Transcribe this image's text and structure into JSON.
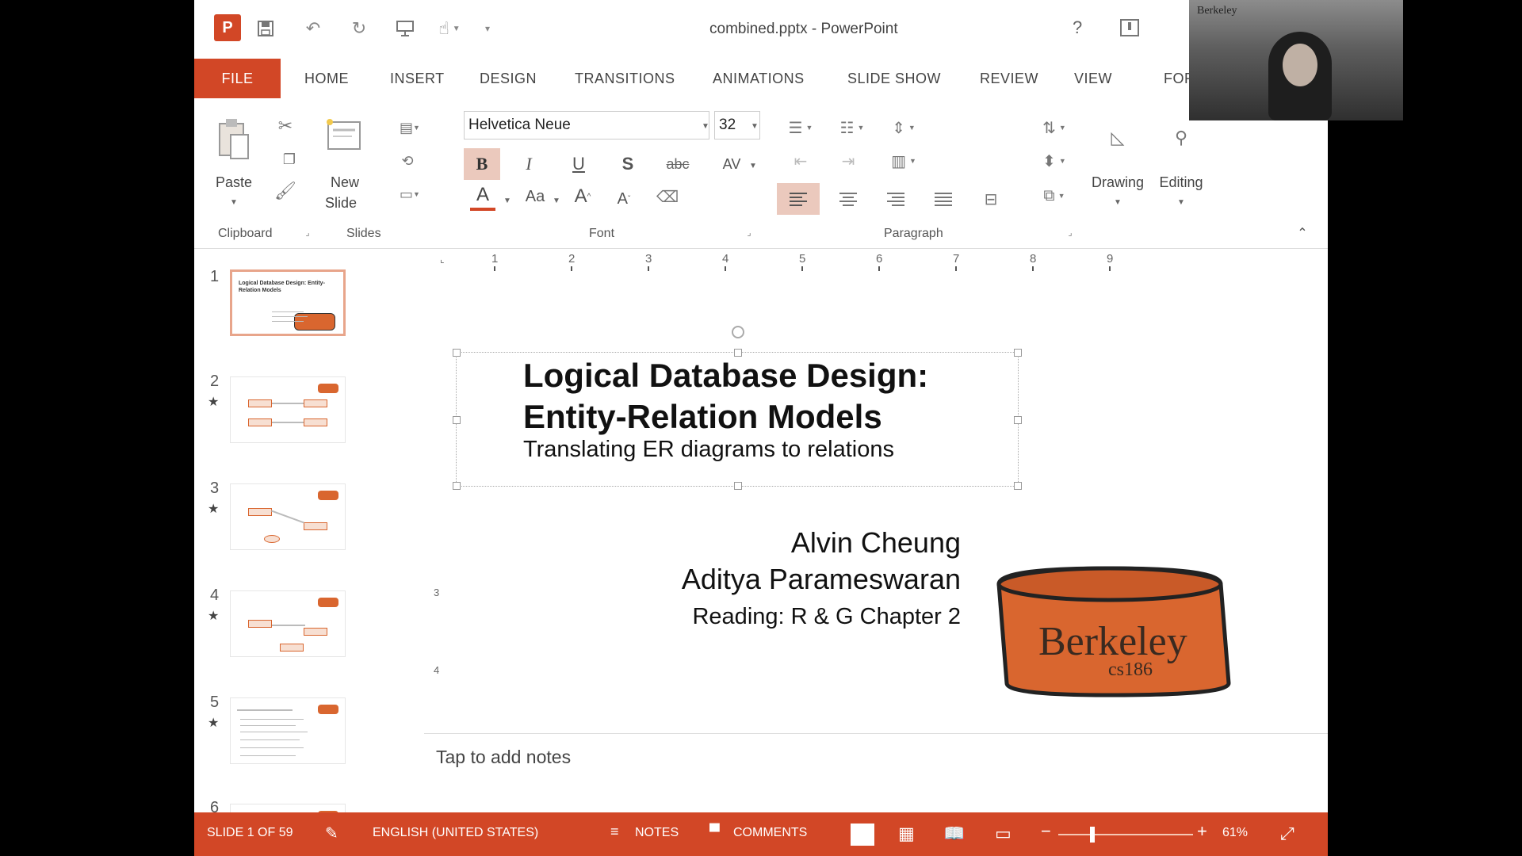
{
  "window": {
    "title": "combined.pptx - PowerPoint",
    "help": "?"
  },
  "qat": {
    "app_icon": "P",
    "save_icon": "save-icon",
    "undo_icon": "undo-icon",
    "redo_icon": "redo-icon",
    "present_icon": "present-from-beginning-icon",
    "touch_icon": "touch-mode-icon",
    "customize_icon": "customize-qat-icon"
  },
  "tabs": [
    "FILE",
    "HOME",
    "INSERT",
    "DESIGN",
    "TRANSITIONS",
    "ANIMATIONS",
    "SLIDE SHOW",
    "REVIEW",
    "VIEW",
    "FOR"
  ],
  "ribbon": {
    "paste_label": "Paste",
    "new_slide_label_1": "New",
    "new_slide_label_2": "Slide",
    "font_name": "Helvetica Neue",
    "font_size": "32",
    "drawing_label": "Drawing",
    "editing_label": "Editing",
    "groups": {
      "clipboard": "Clipboard",
      "slides": "Slides",
      "font": "Font",
      "paragraph": "Paragraph"
    },
    "glyphs": {
      "bold": "B",
      "italic": "I",
      "underline": "U",
      "shadow": "S",
      "strike": "abc",
      "spacing": "AV",
      "font_color": "A",
      "change_case": "Aa",
      "grow": "A",
      "shrink": "A"
    }
  },
  "ruler": {
    "numbers": [
      "1",
      "2",
      "3",
      "4",
      "5",
      "6",
      "7",
      "8",
      "9"
    ],
    "vertical_numbers": [
      "3",
      "4"
    ]
  },
  "thumbnails": [
    {
      "num": "1",
      "title": "Logical Database Design: Entity-Relation Models",
      "starred": false,
      "active": true
    },
    {
      "num": "2",
      "title": "",
      "starred": true,
      "active": false
    },
    {
      "num": "3",
      "title": "",
      "starred": true,
      "active": false
    },
    {
      "num": "4",
      "title": "",
      "starred": true,
      "active": false
    },
    {
      "num": "5",
      "title": "",
      "starred": true,
      "active": false
    },
    {
      "num": "6",
      "title": "",
      "starred": false,
      "active": false
    }
  ],
  "slide": {
    "title_line1": "Logical Database Design:",
    "title_line2": "Entity-Relation Models",
    "subtitle": "Translating ER diagrams to relations",
    "author1": "Alvin Cheung",
    "author2": "Aditya Parameswaran",
    "reading": "Reading: R & G Chapter 2",
    "logo_text": "Berkeley",
    "logo_subtext": "cs186"
  },
  "notes": {
    "placeholder": "Tap to add notes"
  },
  "status": {
    "slide_counter": "SLIDE 1 OF 59",
    "language": "ENGLISH (UNITED STATES)",
    "notes": "NOTES",
    "comments": "COMMENTS",
    "zoom": "61%",
    "minus": "−",
    "plus": "+"
  },
  "webcam": {
    "brand": "Berkeley"
  },
  "colors": {
    "accent": "#d24726",
    "selected_button": "#ebc9bd",
    "logo_orange": "#d9662f"
  }
}
